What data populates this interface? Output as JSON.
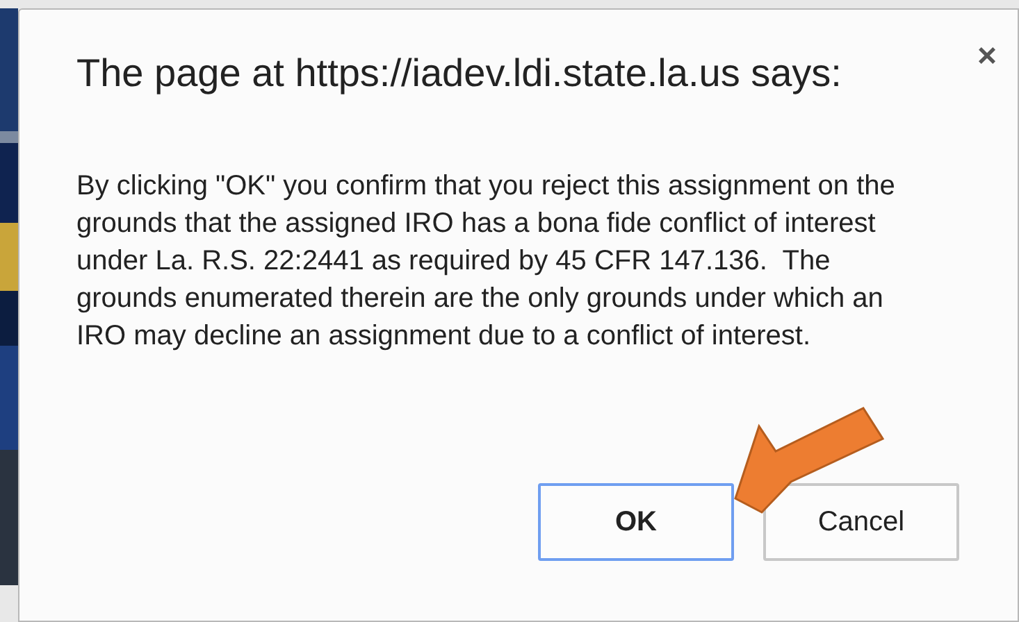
{
  "dialog": {
    "title": "The page at https://iadev.ldi.state.la.us says:",
    "close": "×",
    "message": "By clicking \"OK\" you confirm that you reject this assignment on the grounds that the assigned IRO has a bona fide conflict of interest under La. R.S. 22:2441 as required by 45 CFR 147.136.  The grounds enumerated therein are the only grounds under which an IRO may decline an assignment due to a conflict of interest.",
    "buttons": [
      {
        "label": "OK",
        "selected": true
      },
      {
        "label": "Cancel",
        "selected": false
      }
    ]
  }
}
